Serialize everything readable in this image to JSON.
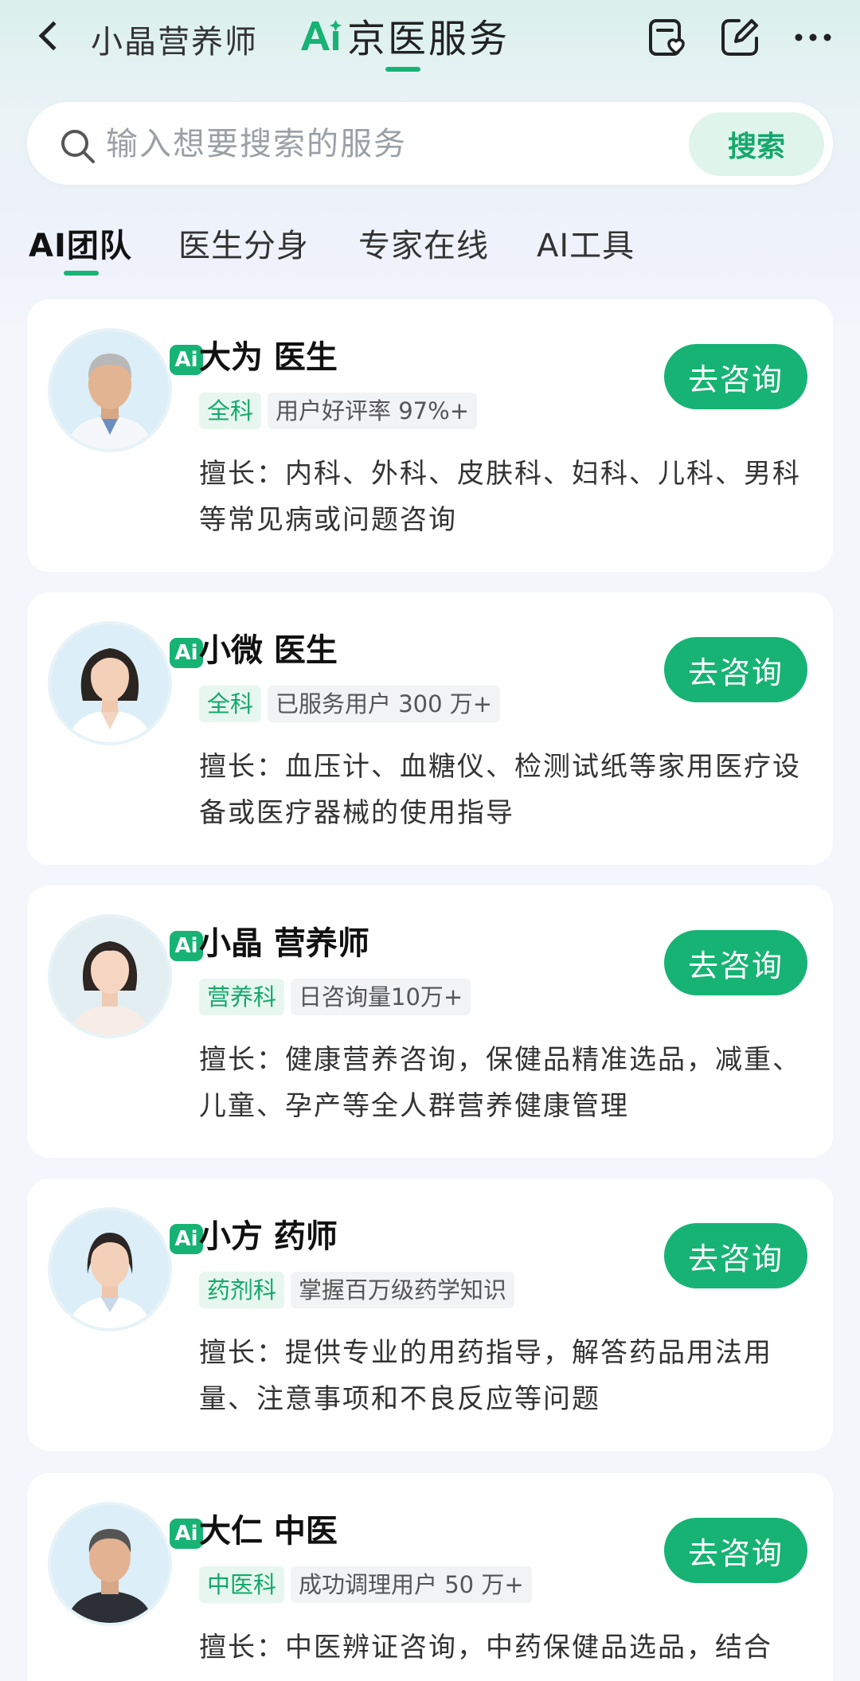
{
  "header": {
    "back_label": "<",
    "left_title": "小晶营养师",
    "right_title": "京医服务",
    "logo_text": "Ai",
    "icons": [
      "favorite-list-icon",
      "edit-icon",
      "more-icon"
    ]
  },
  "search": {
    "placeholder": "输入想要搜索的服务",
    "button_label": "搜索"
  },
  "tabs": [
    {
      "label": "AI团队",
      "active": true
    },
    {
      "label": "医生分身",
      "active": false
    },
    {
      "label": "专家在线",
      "active": false
    },
    {
      "label": "AI工具",
      "active": false
    }
  ],
  "cards": [
    {
      "name": "大为  医生",
      "dept": "全科",
      "stat": "用户好评率 97%+",
      "desc": "擅长：内科、外科、皮肤科、妇科、儿科、男科等常见病或问题咨询",
      "button": "去咨询",
      "badge": "Ai"
    },
    {
      "name": "小微  医生",
      "dept": "全科",
      "stat": "已服务用户 300 万+",
      "desc": "擅长：血压计、血糖仪、检测试纸等家用医疗设备或医疗器械的使用指导",
      "button": "去咨询",
      "badge": "Ai"
    },
    {
      "name": "小晶  营养师",
      "dept": "营养科",
      "stat": "日咨询量10万+",
      "desc": "擅长：健康营养咨询，保健品精准选品，减重、儿童、孕产等全人群营养健康管理",
      "button": "去咨询",
      "badge": "Ai"
    },
    {
      "name": "小方  药师",
      "dept": "药剂科",
      "stat": "掌握百万级药学知识",
      "desc": "擅长：提供专业的用药指导，解答药品用法用量、注意事项和不良反应等问题",
      "button": "去咨询",
      "badge": "Ai"
    },
    {
      "name": "大仁  中医",
      "dept": "中医科",
      "stat": "成功调理用户 50 万+",
      "desc": "擅长：中医辨证咨询，中药保健品选品，结合",
      "button": "去咨询",
      "badge": "Ai"
    }
  ],
  "colors": {
    "accent": "#17b374",
    "accent_light": "#e7f7ef",
    "card_bg": "#ffffff",
    "page_bg": "#f4f6fb"
  }
}
